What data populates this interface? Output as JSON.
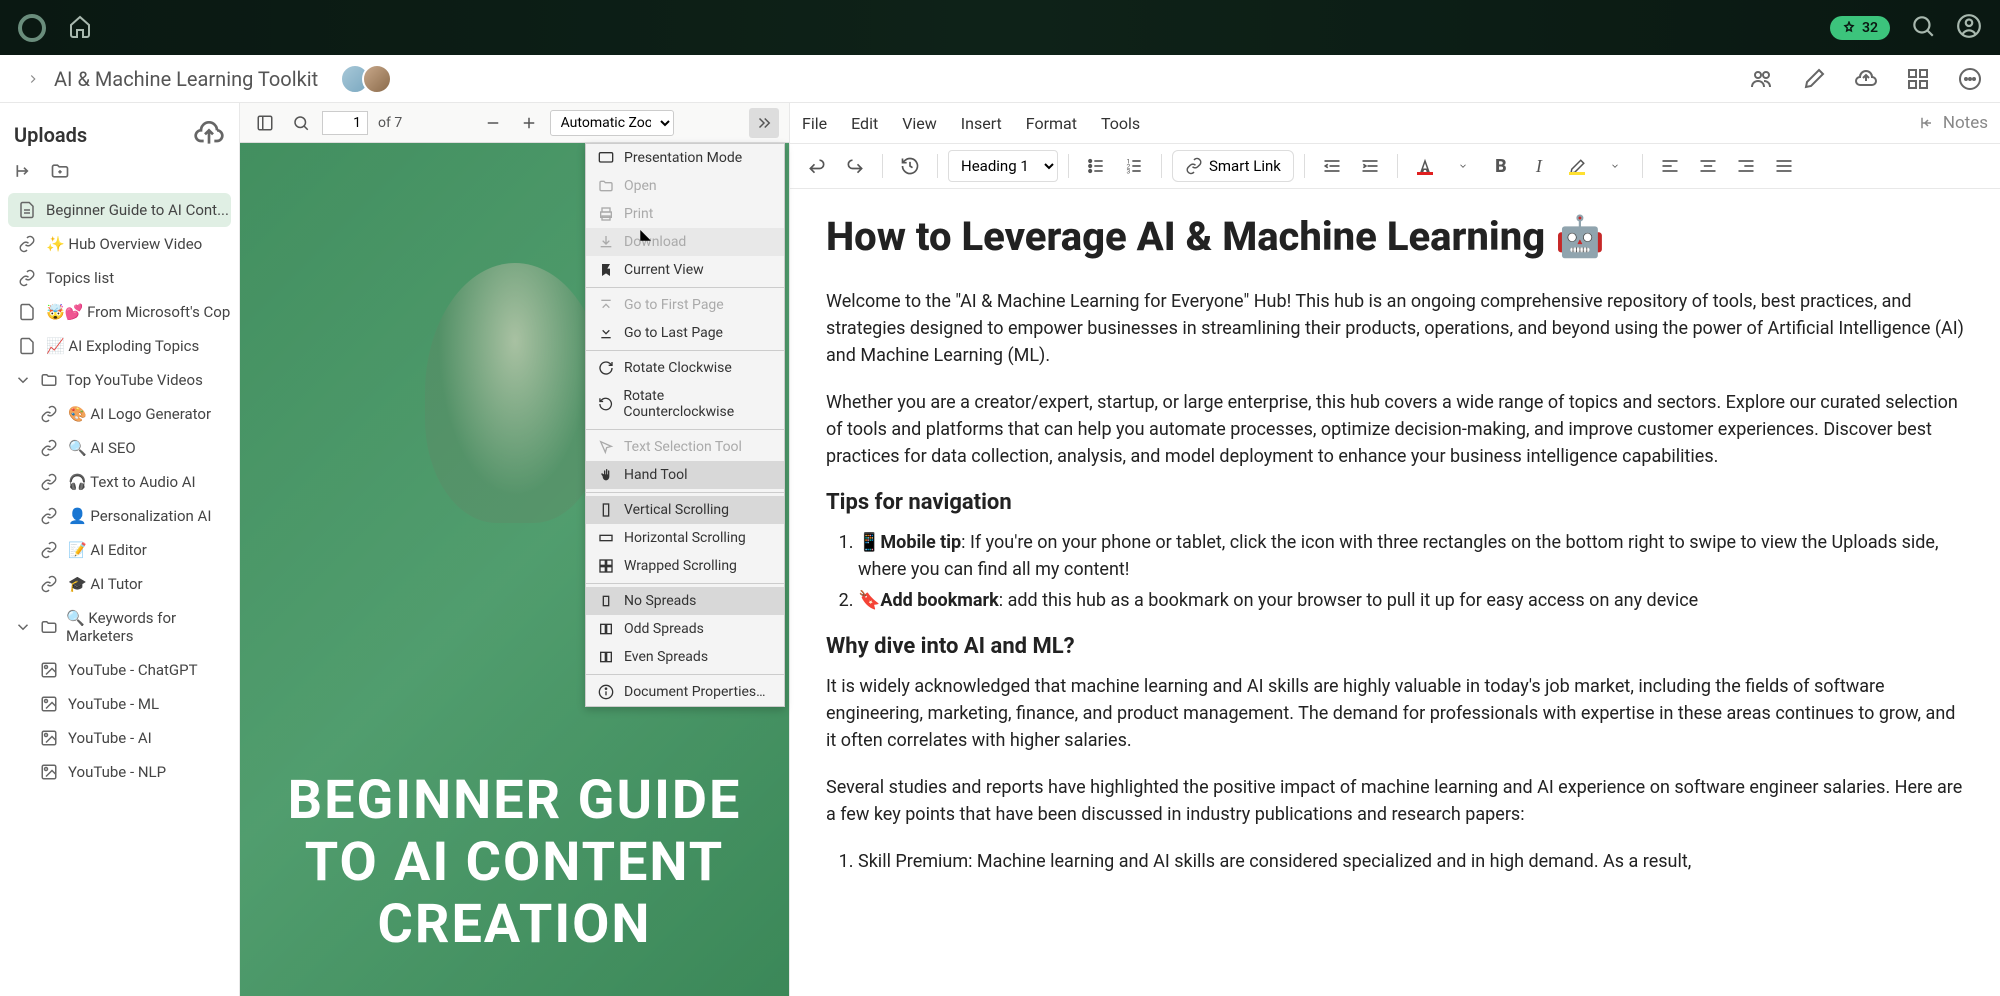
{
  "topbar": {
    "badge_count": "32"
  },
  "header": {
    "breadcrumb": "AI & Machine Learning Toolkit",
    "notes_label": "Notes"
  },
  "sidebar": {
    "title": "Uploads",
    "items": [
      {
        "label": "Beginner Guide to AI Cont...",
        "icon": "doc",
        "active": true
      },
      {
        "label": "✨ Hub Overview Video",
        "icon": "link"
      },
      {
        "label": "Topics list",
        "icon": "link"
      },
      {
        "label": "🤯💕 From Microsoft's Cop...",
        "icon": "doc"
      },
      {
        "label": "📈 AI Exploding Topics",
        "icon": "doc"
      }
    ],
    "folders": [
      {
        "label": "Top YouTube Videos",
        "children": [
          {
            "label": "🎨 AI Logo Generator",
            "icon": "link"
          },
          {
            "label": "🔍 AI SEO",
            "icon": "link"
          },
          {
            "label": "🎧 Text to Audio AI",
            "icon": "link"
          },
          {
            "label": "👤 Personalization AI",
            "icon": "link"
          },
          {
            "label": "📝 AI Editor",
            "icon": "link"
          },
          {
            "label": "🎓 AI Tutor",
            "icon": "link"
          }
        ]
      },
      {
        "label": "🔍 Keywords for Marketers",
        "children": [
          {
            "label": "YouTube - ChatGPT",
            "icon": "image"
          },
          {
            "label": "YouTube - ML",
            "icon": "image"
          },
          {
            "label": "YouTube - AI",
            "icon": "image"
          },
          {
            "label": "YouTube - NLP",
            "icon": "image"
          }
        ]
      }
    ]
  },
  "pdf": {
    "page_current": "1",
    "page_total": "of 7",
    "zoom": "Automatic Zoom",
    "overlay_title": "BEGINNER GUIDE\nTO AI CONTENT\nCREATION",
    "menu": {
      "presentation": "Presentation Mode",
      "open": "Open",
      "print": "Print",
      "download": "Download",
      "current_view": "Current View",
      "first_page": "Go to First Page",
      "last_page": "Go to Last Page",
      "rotate_cw": "Rotate Clockwise",
      "rotate_ccw": "Rotate Counterclockwise",
      "text_select": "Text Selection Tool",
      "hand_tool": "Hand Tool",
      "v_scroll": "Vertical Scrolling",
      "h_scroll": "Horizontal Scrolling",
      "w_scroll": "Wrapped Scrolling",
      "no_spreads": "No Spreads",
      "odd_spreads": "Odd Spreads",
      "even_spreads": "Even Spreads",
      "doc_props": "Document Properties…"
    }
  },
  "editor": {
    "menus": [
      "File",
      "Edit",
      "View",
      "Insert",
      "Format",
      "Tools"
    ],
    "heading_label": "Heading 1",
    "smart_link": "Smart Link"
  },
  "doc": {
    "title": "How to Leverage AI & Machine Learning 🤖",
    "p1": "Welcome to the \"AI & Machine Learning for Everyone\" Hub! This hub is an ongoing comprehensive repository of tools, best practices, and strategies designed to empower businesses in streamlining their products, operations, and beyond using the power of Artificial Intelligence (AI) and Machine Learning (ML).",
    "p2": "Whether you are a creator/expert, startup, or large enterprise, this hub covers a wide range of topics and sectors. Explore our curated selection of tools and platforms that can help you automate processes, optimize decision-making, and improve customer experiences. Discover best practices for data collection, analysis, and model deployment to enhance your business intelligence capabilities.",
    "h2_1": "Tips for navigation",
    "tip1_prefix": "📱Mobile tip",
    "tip1_body": ": If you're on your phone or tablet, click the icon with three rectangles on the bottom right to swipe to view the Uploads side, where you can find all my content!",
    "tip2_prefix": "🔖Add bookmark",
    "tip2_body": ": add this hub as a bookmark on your browser to pull it up for easy access on any device",
    "h2_2": "Why dive into AI and ML?",
    "p3": "It is widely acknowledged that machine learning and AI skills are highly valuable in today's job market, including the fields of software engineering, marketing, finance, and product management. The demand for professionals with expertise in these areas continues to grow, and it often correlates with higher salaries.",
    "p4": "Several studies and reports have highlighted the positive impact of machine learning and AI experience on software engineer salaries. Here are a few key points that have been discussed in industry publications and research papers:",
    "li1": "Skill Premium: Machine learning and AI skills are considered specialized and in high demand. As a result,"
  }
}
